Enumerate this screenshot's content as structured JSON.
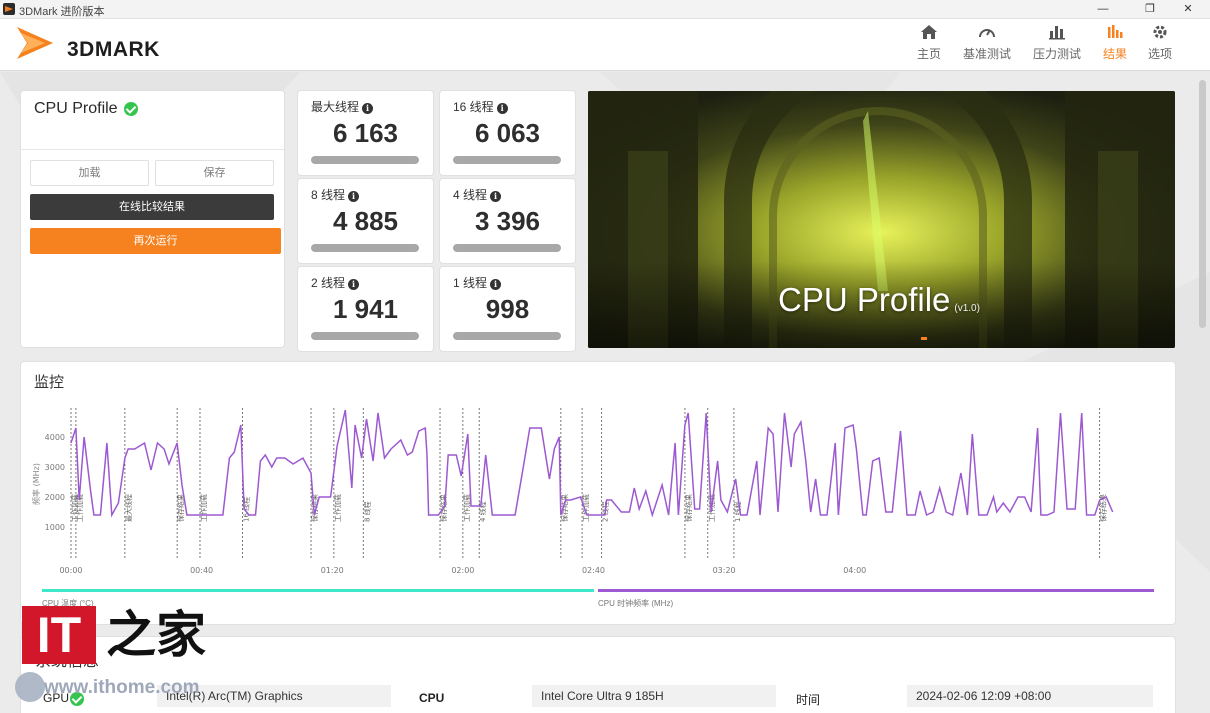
{
  "window": {
    "title": "3DMark 进阶版本",
    "controls": [
      "—",
      "❐",
      "✕"
    ]
  },
  "header": {
    "logo_text": "3DMARK",
    "nav": [
      {
        "label": "主页",
        "icon": "home-icon"
      },
      {
        "label": "基准测试",
        "icon": "speedometer-icon"
      },
      {
        "label": "压力测试",
        "icon": "bar-chart-icon"
      },
      {
        "label": "结果",
        "icon": "results-icon",
        "active": true
      },
      {
        "label": "选项",
        "icon": "gear-icon"
      }
    ],
    "accent_color": "#f5821f"
  },
  "result": {
    "title": "CPU Profile",
    "load_label": "加载",
    "save_label": "保存",
    "compare_label": "在线比较结果",
    "rerun_label": "再次运行"
  },
  "scores": [
    {
      "label": "最大线程",
      "value": "6 163"
    },
    {
      "label": "16 线程",
      "value": "6 063"
    },
    {
      "label": "8 线程",
      "value": "4 885"
    },
    {
      "label": "4 线程",
      "value": "3 396"
    },
    {
      "label": "2 线程",
      "value": "1 941"
    },
    {
      "label": "1 线程",
      "value": "998"
    }
  ],
  "hero": {
    "title": "CPU Profile",
    "version": "(v1.0)"
  },
  "monitor": {
    "title": "监控",
    "legend": [
      {
        "label": "CPU 温度 (°C)",
        "color": "#3ee8c8"
      },
      {
        "label": "CPU 时钟频率 (MHz)",
        "color": "#9c59d1"
      }
    ]
  },
  "chart_data": {
    "type": "line",
    "ylabel": "频率 (MHz)",
    "ylim": [
      0,
      4900
    ],
    "yticks": [
      "1000",
      "2000",
      "3000",
      "4000"
    ],
    "xticks": [
      "00:00",
      "00:40",
      "01:20",
      "02:00",
      "02:40",
      "03:20",
      "04:00"
    ],
    "xlim": [
      0,
      265
    ],
    "phase_markers": [
      {
        "t": 0,
        "label": "工作加载"
      },
      {
        "t": 3,
        "label": "工作加载"
      },
      {
        "t": 33,
        "label": "最大线程"
      },
      {
        "t": 65,
        "label": "保存结果"
      },
      {
        "t": 79,
        "label": "工作加载"
      },
      {
        "t": 105,
        "label": "16 线程"
      },
      {
        "t": 147,
        "label": "保存结果"
      },
      {
        "t": 161,
        "label": "工作加载"
      },
      {
        "t": 179,
        "label": "8 线程"
      },
      {
        "t": 226,
        "label": "保存结果"
      },
      {
        "t": 240,
        "label": "工作加载"
      },
      {
        "t": 250,
        "label": "4 线程"
      },
      {
        "t": 300,
        "label": "保存结果"
      },
      {
        "t": 313,
        "label": "工作加载"
      },
      {
        "t": 325,
        "label": "2 线程"
      },
      {
        "t": 376,
        "label": "保存结果"
      },
      {
        "t": 390,
        "label": "工作加载"
      },
      {
        "t": 406,
        "label": "1 线程"
      },
      {
        "t": 630,
        "label": "保存结果"
      }
    ],
    "series": [
      {
        "name": "CPU 时钟频率 (MHz)",
        "color": "#9c59d1",
        "points": [
          [
            0,
            3800
          ],
          [
            3,
            4300
          ],
          [
            5,
            1900
          ],
          [
            8,
            4000
          ],
          [
            12,
            2200
          ],
          [
            14,
            1400
          ],
          [
            18,
            1400
          ],
          [
            22,
            3800
          ],
          [
            25,
            1400
          ],
          [
            29,
            1800
          ],
          [
            33,
            3300
          ],
          [
            35,
            3600
          ],
          [
            39,
            3600
          ],
          [
            45,
            3800
          ],
          [
            49,
            2900
          ],
          [
            53,
            3800
          ],
          [
            57,
            3600
          ],
          [
            60,
            3100
          ],
          [
            65,
            3800
          ],
          [
            68,
            2400
          ],
          [
            71,
            1400
          ],
          [
            78,
            1400
          ],
          [
            81,
            1400
          ],
          [
            87,
            1400
          ],
          [
            93,
            1400
          ],
          [
            97,
            3300
          ],
          [
            100,
            3500
          ],
          [
            104,
            4400
          ],
          [
            106,
            1600
          ],
          [
            109,
            1400
          ],
          [
            113,
            1400
          ],
          [
            116,
            3200
          ],
          [
            119,
            3400
          ],
          [
            123,
            3000
          ],
          [
            126,
            3300
          ],
          [
            131,
            3300
          ],
          [
            136,
            3100
          ],
          [
            142,
            3300
          ],
          [
            147,
            2800
          ],
          [
            149,
            1400
          ],
          [
            152,
            2000
          ],
          [
            159,
            2000
          ],
          [
            163,
            3700
          ],
          [
            168,
            4900
          ],
          [
            172,
            2300
          ],
          [
            174,
            4400
          ],
          [
            178,
            3300
          ],
          [
            181,
            4600
          ],
          [
            185,
            3200
          ],
          [
            188,
            4800
          ],
          [
            192,
            3300
          ],
          [
            196,
            3600
          ],
          [
            202,
            3900
          ],
          [
            206,
            3400
          ],
          [
            209,
            3500
          ],
          [
            213,
            4200
          ],
          [
            217,
            4300
          ],
          [
            218,
            3400
          ],
          [
            219,
            1400
          ],
          [
            225,
            1400
          ],
          [
            229,
            1700
          ],
          [
            231,
            3400
          ],
          [
            236,
            3400
          ],
          [
            239,
            2700
          ],
          [
            243,
            4100
          ],
          [
            245,
            1700
          ],
          [
            251,
            1700
          ],
          [
            254,
            3400
          ],
          [
            258,
            1400
          ],
          [
            266,
            1400
          ],
          [
            272,
            1400
          ],
          [
            277,
            3000
          ],
          [
            281,
            4300
          ],
          [
            284,
            4300
          ],
          [
            288,
            4300
          ],
          [
            293,
            2600
          ],
          [
            296,
            3600
          ],
          [
            299,
            4000
          ],
          [
            300,
            1400
          ],
          [
            303,
            1900
          ],
          [
            306,
            1900
          ],
          [
            312,
            2000
          ],
          [
            316,
            1400
          ],
          [
            320,
            1400
          ],
          [
            327,
            1400
          ],
          [
            328,
            1900
          ],
          [
            331,
            1900
          ],
          [
            337,
            1500
          ],
          [
            342,
            1500
          ],
          [
            345,
            2300
          ],
          [
            348,
            1600
          ],
          [
            352,
            2200
          ],
          [
            356,
            1400
          ],
          [
            362,
            2400
          ],
          [
            366,
            1400
          ],
          [
            370,
            3800
          ],
          [
            372,
            1400
          ],
          [
            376,
            4400
          ],
          [
            378,
            4800
          ],
          [
            382,
            1600
          ],
          [
            385,
            1600
          ],
          [
            389,
            4800
          ],
          [
            392,
            1500
          ],
          [
            396,
            3200
          ],
          [
            398,
            1900
          ],
          [
            402,
            1500
          ],
          [
            407,
            2600
          ],
          [
            410,
            1400
          ],
          [
            414,
            1400
          ],
          [
            420,
            3200
          ],
          [
            422,
            1400
          ],
          [
            427,
            4300
          ],
          [
            430,
            4100
          ],
          [
            433,
            1500
          ],
          [
            437,
            4800
          ],
          [
            441,
            3000
          ],
          [
            443,
            4100
          ],
          [
            447,
            4500
          ],
          [
            450,
            3200
          ],
          [
            453,
            1500
          ],
          [
            456,
            2600
          ],
          [
            459,
            1400
          ],
          [
            463,
            1400
          ],
          [
            468,
            3800
          ],
          [
            470,
            1400
          ],
          [
            474,
            4300
          ],
          [
            479,
            4400
          ],
          [
            481,
            3600
          ],
          [
            485,
            1400
          ],
          [
            487,
            1400
          ],
          [
            491,
            3200
          ],
          [
            495,
            3300
          ],
          [
            499,
            1500
          ],
          [
            503,
            1500
          ],
          [
            508,
            4200
          ],
          [
            512,
            1400
          ],
          [
            517,
            1400
          ],
          [
            520,
            2200
          ],
          [
            524,
            1400
          ],
          [
            528,
            1500
          ],
          [
            532,
            2300
          ],
          [
            536,
            1500
          ],
          [
            540,
            1400
          ],
          [
            545,
            2800
          ],
          [
            549,
            1400
          ],
          [
            552,
            4100
          ],
          [
            556,
            1400
          ],
          [
            561,
            1400
          ],
          [
            565,
            2000
          ],
          [
            567,
            1500
          ],
          [
            571,
            1800
          ],
          [
            575,
            1500
          ],
          [
            580,
            2000
          ],
          [
            584,
            2000
          ],
          [
            588,
            1500
          ],
          [
            592,
            4300
          ],
          [
            594,
            1400
          ],
          [
            598,
            1400
          ],
          [
            602,
            1500
          ],
          [
            606,
            4800
          ],
          [
            610,
            1600
          ],
          [
            615,
            1600
          ],
          [
            619,
            4800
          ],
          [
            622,
            1400
          ],
          [
            627,
            1400
          ],
          [
            630,
            1900
          ],
          [
            634,
            2000
          ],
          [
            638,
            1500
          ]
        ]
      }
    ]
  },
  "system": {
    "title": "系统信息",
    "gpu_key": "GPU",
    "gpu_value": "Intel(R) Arc(TM) Graphics",
    "cpu_key": "CPU",
    "cpu_value": "Intel Core Ultra 9 185H",
    "time_key": "时间",
    "time_value": "2024-02-06 12:09 +08:00"
  },
  "watermark": {
    "it": "IT",
    "zh": "之家",
    "url": "www.ithome.com"
  }
}
